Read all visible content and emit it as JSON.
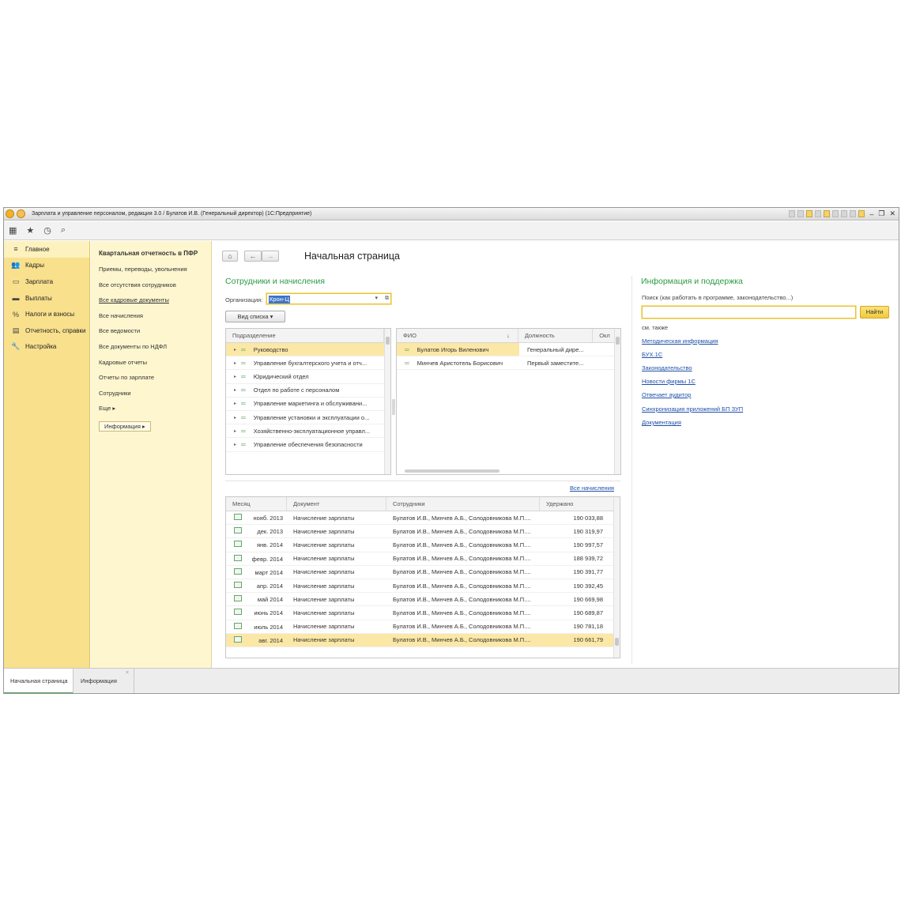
{
  "window": {
    "title": "Зарплата и управление персоналом, редакция 3.0 / Булатов И.В. (Генеральный директор) (1С:Предприятие)"
  },
  "sections": [
    {
      "label": "Главное",
      "icon": "menu-lines-icon"
    },
    {
      "label": "Кадры",
      "icon": "people-icon"
    },
    {
      "label": "Зарплата",
      "icon": "wallet-icon"
    },
    {
      "label": "Выплаты",
      "icon": "money-icon"
    },
    {
      "label": "Налоги и взносы",
      "icon": "percent-icon"
    },
    {
      "label": "Отчетность, справки",
      "icon": "report-icon"
    },
    {
      "label": "Настройка",
      "icon": "wrench-icon"
    }
  ],
  "nav": {
    "title": "Квартальная отчетность в ПФР",
    "items": [
      "Приемы, переводы, увольнения",
      "Все отсутствия сотрудников",
      "Все кадровые документы",
      "Все начисления",
      "Все ведомости",
      "Все документы по НДФЛ",
      "Кадровые отчеты",
      "Отчеты по зарплате",
      "Сотрудники",
      "Еще ▸"
    ],
    "info_button": "Информация ▸"
  },
  "page": {
    "title": "Начальная страница",
    "employees_header": "Сотрудники и начисления",
    "org_label": "Организация:",
    "org_value": "Крон-Ц",
    "view_button": "Вид списка",
    "all_accruals_link": "Все начисления"
  },
  "departments": {
    "header": "Подразделение",
    "rows": [
      "Руководство",
      "Управление бухгалтерского учета и отч...",
      "Юридический отдел",
      "Отдел по работе с персоналом",
      "Управление маркетинга и обслуживани...",
      "Управление установки и эксплуатации о...",
      "Хозяйственно-эксплуатационное управл...",
      "Управление обеспечения безопасности"
    ]
  },
  "employees": {
    "headers": [
      "ФИО",
      "Должность",
      "Окл"
    ],
    "sort_mark": "↓",
    "rows": [
      {
        "name": "Булатов Игорь Виленович",
        "position": "Генеральный дире..."
      },
      {
        "name": "Минчев Аристотель Борисович",
        "position": "Первый заместите..."
      }
    ]
  },
  "accruals": {
    "headers": [
      "Месяц",
      "Документ",
      "Сотрудники",
      "Удержано"
    ],
    "rows": [
      {
        "month": "нояб. 2013",
        "doc": "Начисление зарплаты",
        "employees": "Булатов И.В., Минчев А.Б., Солодовникова М.П....",
        "amount": "190 033,88"
      },
      {
        "month": "дек. 2013",
        "doc": "Начисление зарплаты",
        "employees": "Булатов И.В., Минчев А.Б., Солодовникова М.П....",
        "amount": "190 319,97"
      },
      {
        "month": "янв. 2014",
        "doc": "Начисление зарплаты",
        "employees": "Булатов И.В., Минчев А.Б., Солодовникова М.П....",
        "amount": "190 997,57"
      },
      {
        "month": "февр. 2014",
        "doc": "Начисление зарплаты",
        "employees": "Булатов И.В., Минчев А.Б., Солодовникова М.П....",
        "amount": "188 939,72"
      },
      {
        "month": "март 2014",
        "doc": "Начисление зарплаты",
        "employees": "Булатов И.В., Минчев А.Б., Солодовникова М.П....",
        "amount": "190 391,77"
      },
      {
        "month": "апр. 2014",
        "doc": "Начисление зарплаты",
        "employees": "Булатов И.В., Минчев А.Б., Солодовникова М.П....",
        "amount": "190 392,45"
      },
      {
        "month": "май 2014",
        "doc": "Начисление зарплаты",
        "employees": "Булатов И.В., Минчев А.Б., Солодовникова М.П....",
        "amount": "190 669,98"
      },
      {
        "month": "июнь 2014",
        "doc": "Начисление зарплаты",
        "employees": "Булатов И.В., Минчев А.Б., Солодовникова М.П....",
        "amount": "190 689,87"
      },
      {
        "month": "июль 2014",
        "doc": "Начисление зарплаты",
        "employees": "Булатов И.В., Минчев А.Б., Солодовникова М.П....",
        "amount": "190 781,18"
      },
      {
        "month": "авг. 2014",
        "doc": "Начисление зарплаты",
        "employees": "Булатов И.В., Минчев А.Б., Солодовникова М.П....",
        "amount": "190 661,79"
      }
    ]
  },
  "support": {
    "header": "Информация и поддержка",
    "search_label": "Поиск (как работать в программе, законодательство...)",
    "search_value": "",
    "search_button": "Найти",
    "see_also": "см. также",
    "links": [
      "Методическая информация",
      "БУХ.1С",
      "Законодательство",
      "Новости фирмы 1С",
      "Отвечает аудитор",
      "Синхронизация приложений БП ЗУП",
      "Документация"
    ]
  },
  "tabs": [
    "Начальная страница",
    "Информация"
  ],
  "colors": {
    "sections_bg": "#f9e08c",
    "nav_bg": "#fdf6cf",
    "accent_green": "#2e9a46",
    "selection": "#fbe8a6",
    "link": "#1f4fa8"
  }
}
